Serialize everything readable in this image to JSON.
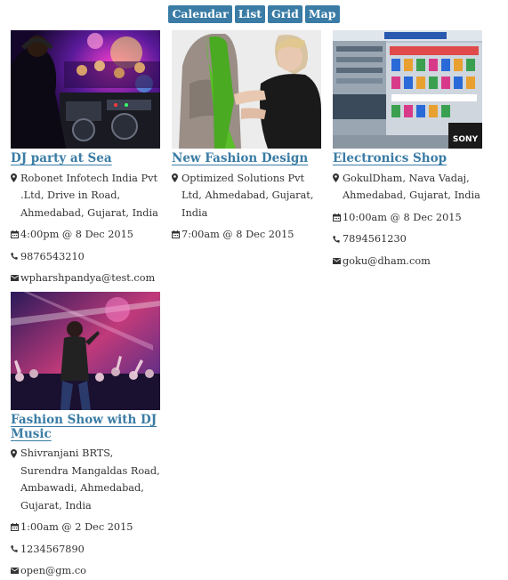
{
  "view_tabs": [
    {
      "label": "Calendar"
    },
    {
      "label": "List"
    },
    {
      "label": "Grid"
    },
    {
      "label": "Map"
    }
  ],
  "events": [
    {
      "title": "DJ party at Sea",
      "address": "Robonet Infotech India Pvt .Ltd, Drive in Road, Ahmedabad, Gujarat, India",
      "datetime": "4:00pm @ 8 Dec 2015",
      "phone": "9876543210",
      "email": "wpharshpandya@test.com"
    },
    {
      "title": "New Fashion Design",
      "address": "Optimized Solutions Pvt Ltd, Ahmedabad, Gujarat, India",
      "datetime": "7:00am @ 8 Dec 2015"
    },
    {
      "title": "Electronics Shop",
      "address": "GokulDham, Nava Vadaj, Ahmedabad, Gujarat, India",
      "datetime": "10:00am @ 8 Dec 2015",
      "phone": "7894561230",
      "email": "goku@dham.com"
    },
    {
      "title": "Fashion Show with DJ Music",
      "address": "Shivranjani BRTS, Surendra Mangaldas Road, Ambawadi, Ahmedabad, Gujarat, India",
      "datetime": "1:00am @ 2 Dec 2015",
      "phone": "1234567890",
      "email": "open@gm.co"
    }
  ],
  "photo_brand_sign": "SONY",
  "icons": {
    "address": "map-marker-icon",
    "datetime": "calendar-icon",
    "phone": "phone-icon",
    "email": "envelope-icon"
  },
  "colors": {
    "accent": "#3a7ca5",
    "text": "#333333",
    "background": "#ffffff"
  }
}
